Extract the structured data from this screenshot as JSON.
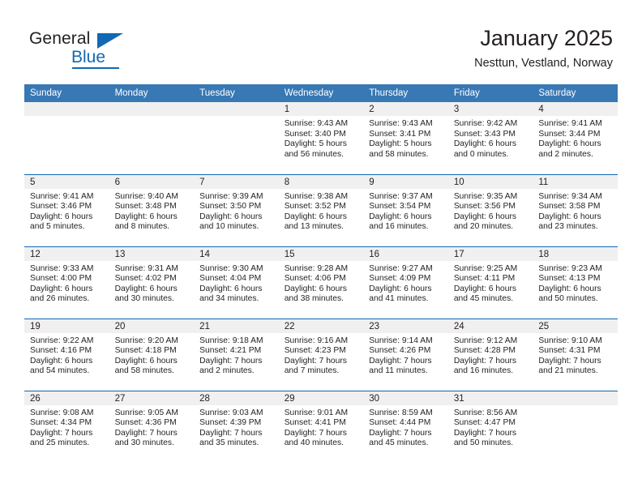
{
  "brand": {
    "name_part1": "General",
    "name_part2": "Blue",
    "triangle_color": "#1268b3",
    "accent_color": "#1268b3"
  },
  "header": {
    "title": "January 2025",
    "location": "Nesttun, Vestland, Norway",
    "header_bg": "#3878b4",
    "row_border": "#1268b3",
    "daynum_bg": "#f0f0f0"
  },
  "weekdays": [
    "Sunday",
    "Monday",
    "Tuesday",
    "Wednesday",
    "Thursday",
    "Friday",
    "Saturday"
  ],
  "weeks": [
    [
      {
        "day": "",
        "blank": true,
        "sunrise": "",
        "sunset": "",
        "daylight": ""
      },
      {
        "day": "",
        "blank": true,
        "sunrise": "",
        "sunset": "",
        "daylight": ""
      },
      {
        "day": "",
        "blank": true,
        "sunrise": "",
        "sunset": "",
        "daylight": ""
      },
      {
        "day": "1",
        "blank": false,
        "sunrise": "Sunrise: 9:43 AM",
        "sunset": "Sunset: 3:40 PM",
        "daylight": "Daylight: 5 hours and 56 minutes."
      },
      {
        "day": "2",
        "blank": false,
        "sunrise": "Sunrise: 9:43 AM",
        "sunset": "Sunset: 3:41 PM",
        "daylight": "Daylight: 5 hours and 58 minutes."
      },
      {
        "day": "3",
        "blank": false,
        "sunrise": "Sunrise: 9:42 AM",
        "sunset": "Sunset: 3:43 PM",
        "daylight": "Daylight: 6 hours and 0 minutes."
      },
      {
        "day": "4",
        "blank": false,
        "sunrise": "Sunrise: 9:41 AM",
        "sunset": "Sunset: 3:44 PM",
        "daylight": "Daylight: 6 hours and 2 minutes."
      }
    ],
    [
      {
        "day": "5",
        "blank": false,
        "sunrise": "Sunrise: 9:41 AM",
        "sunset": "Sunset: 3:46 PM",
        "daylight": "Daylight: 6 hours and 5 minutes."
      },
      {
        "day": "6",
        "blank": false,
        "sunrise": "Sunrise: 9:40 AM",
        "sunset": "Sunset: 3:48 PM",
        "daylight": "Daylight: 6 hours and 8 minutes."
      },
      {
        "day": "7",
        "blank": false,
        "sunrise": "Sunrise: 9:39 AM",
        "sunset": "Sunset: 3:50 PM",
        "daylight": "Daylight: 6 hours and 10 minutes."
      },
      {
        "day": "8",
        "blank": false,
        "sunrise": "Sunrise: 9:38 AM",
        "sunset": "Sunset: 3:52 PM",
        "daylight": "Daylight: 6 hours and 13 minutes."
      },
      {
        "day": "9",
        "blank": false,
        "sunrise": "Sunrise: 9:37 AM",
        "sunset": "Sunset: 3:54 PM",
        "daylight": "Daylight: 6 hours and 16 minutes."
      },
      {
        "day": "10",
        "blank": false,
        "sunrise": "Sunrise: 9:35 AM",
        "sunset": "Sunset: 3:56 PM",
        "daylight": "Daylight: 6 hours and 20 minutes."
      },
      {
        "day": "11",
        "blank": false,
        "sunrise": "Sunrise: 9:34 AM",
        "sunset": "Sunset: 3:58 PM",
        "daylight": "Daylight: 6 hours and 23 minutes."
      }
    ],
    [
      {
        "day": "12",
        "blank": false,
        "sunrise": "Sunrise: 9:33 AM",
        "sunset": "Sunset: 4:00 PM",
        "daylight": "Daylight: 6 hours and 26 minutes."
      },
      {
        "day": "13",
        "blank": false,
        "sunrise": "Sunrise: 9:31 AM",
        "sunset": "Sunset: 4:02 PM",
        "daylight": "Daylight: 6 hours and 30 minutes."
      },
      {
        "day": "14",
        "blank": false,
        "sunrise": "Sunrise: 9:30 AM",
        "sunset": "Sunset: 4:04 PM",
        "daylight": "Daylight: 6 hours and 34 minutes."
      },
      {
        "day": "15",
        "blank": false,
        "sunrise": "Sunrise: 9:28 AM",
        "sunset": "Sunset: 4:06 PM",
        "daylight": "Daylight: 6 hours and 38 minutes."
      },
      {
        "day": "16",
        "blank": false,
        "sunrise": "Sunrise: 9:27 AM",
        "sunset": "Sunset: 4:09 PM",
        "daylight": "Daylight: 6 hours and 41 minutes."
      },
      {
        "day": "17",
        "blank": false,
        "sunrise": "Sunrise: 9:25 AM",
        "sunset": "Sunset: 4:11 PM",
        "daylight": "Daylight: 6 hours and 45 minutes."
      },
      {
        "day": "18",
        "blank": false,
        "sunrise": "Sunrise: 9:23 AM",
        "sunset": "Sunset: 4:13 PM",
        "daylight": "Daylight: 6 hours and 50 minutes."
      }
    ],
    [
      {
        "day": "19",
        "blank": false,
        "sunrise": "Sunrise: 9:22 AM",
        "sunset": "Sunset: 4:16 PM",
        "daylight": "Daylight: 6 hours and 54 minutes."
      },
      {
        "day": "20",
        "blank": false,
        "sunrise": "Sunrise: 9:20 AM",
        "sunset": "Sunset: 4:18 PM",
        "daylight": "Daylight: 6 hours and 58 minutes."
      },
      {
        "day": "21",
        "blank": false,
        "sunrise": "Sunrise: 9:18 AM",
        "sunset": "Sunset: 4:21 PM",
        "daylight": "Daylight: 7 hours and 2 minutes."
      },
      {
        "day": "22",
        "blank": false,
        "sunrise": "Sunrise: 9:16 AM",
        "sunset": "Sunset: 4:23 PM",
        "daylight": "Daylight: 7 hours and 7 minutes."
      },
      {
        "day": "23",
        "blank": false,
        "sunrise": "Sunrise: 9:14 AM",
        "sunset": "Sunset: 4:26 PM",
        "daylight": "Daylight: 7 hours and 11 minutes."
      },
      {
        "day": "24",
        "blank": false,
        "sunrise": "Sunrise: 9:12 AM",
        "sunset": "Sunset: 4:28 PM",
        "daylight": "Daylight: 7 hours and 16 minutes."
      },
      {
        "day": "25",
        "blank": false,
        "sunrise": "Sunrise: 9:10 AM",
        "sunset": "Sunset: 4:31 PM",
        "daylight": "Daylight: 7 hours and 21 minutes."
      }
    ],
    [
      {
        "day": "26",
        "blank": false,
        "sunrise": "Sunrise: 9:08 AM",
        "sunset": "Sunset: 4:34 PM",
        "daylight": "Daylight: 7 hours and 25 minutes."
      },
      {
        "day": "27",
        "blank": false,
        "sunrise": "Sunrise: 9:05 AM",
        "sunset": "Sunset: 4:36 PM",
        "daylight": "Daylight: 7 hours and 30 minutes."
      },
      {
        "day": "28",
        "blank": false,
        "sunrise": "Sunrise: 9:03 AM",
        "sunset": "Sunset: 4:39 PM",
        "daylight": "Daylight: 7 hours and 35 minutes."
      },
      {
        "day": "29",
        "blank": false,
        "sunrise": "Sunrise: 9:01 AM",
        "sunset": "Sunset: 4:41 PM",
        "daylight": "Daylight: 7 hours and 40 minutes."
      },
      {
        "day": "30",
        "blank": false,
        "sunrise": "Sunrise: 8:59 AM",
        "sunset": "Sunset: 4:44 PM",
        "daylight": "Daylight: 7 hours and 45 minutes."
      },
      {
        "day": "31",
        "blank": false,
        "sunrise": "Sunrise: 8:56 AM",
        "sunset": "Sunset: 4:47 PM",
        "daylight": "Daylight: 7 hours and 50 minutes."
      },
      {
        "day": "",
        "blank": true,
        "sunrise": "",
        "sunset": "",
        "daylight": ""
      }
    ]
  ]
}
